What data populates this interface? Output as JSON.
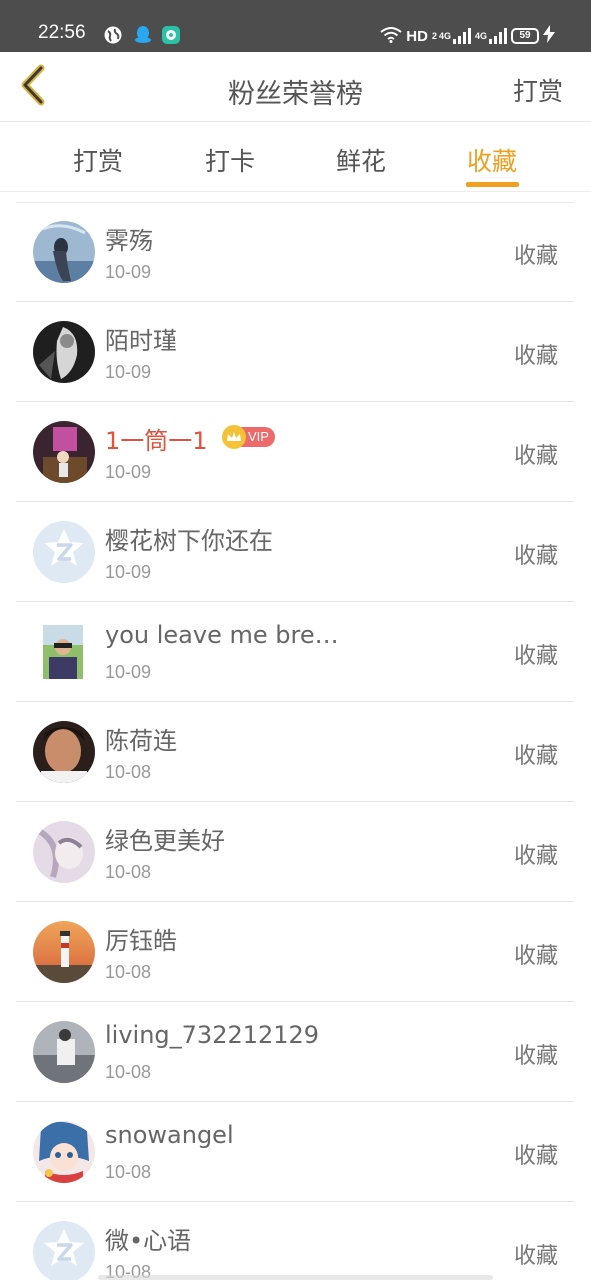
{
  "status_bar": {
    "time": "22:56",
    "left_icons": [
      "globe-icon",
      "qq-icon",
      "chat-app-icon"
    ],
    "hd_label": "HD",
    "hd_sub": "2",
    "net1": "4G",
    "net2": "4G",
    "battery": "59"
  },
  "nav": {
    "title": "粉丝荣誉榜",
    "right_label": "打赏",
    "back_icon": "chevron-left-icon",
    "accent_color": "#f0a020"
  },
  "tabs": [
    {
      "label": "打赏",
      "active": false
    },
    {
      "label": "打卡",
      "active": false
    },
    {
      "label": "鲜花",
      "active": false
    },
    {
      "label": "收藏",
      "active": true
    }
  ],
  "fans": [
    {
      "name": "霁殇",
      "date": "10-09",
      "action": "收藏",
      "vip": false
    },
    {
      "name": "陌时瑾",
      "date": "10-09",
      "action": "收藏",
      "vip": false
    },
    {
      "name": "1一筒一1",
      "date": "10-09",
      "action": "收藏",
      "vip": true,
      "vip_label": "VIP"
    },
    {
      "name": "樱花树下你还在",
      "date": "10-09",
      "action": "收藏",
      "vip": false
    },
    {
      "name": "you leave me brea...",
      "date": "10-09",
      "action": "收藏",
      "vip": false
    },
    {
      "name": "陈荷连",
      "date": "10-08",
      "action": "收藏",
      "vip": false
    },
    {
      "name": "绿色更美好",
      "date": "10-08",
      "action": "收藏",
      "vip": false
    },
    {
      "name": "厉钰皓",
      "date": "10-08",
      "action": "收藏",
      "vip": false
    },
    {
      "name": "living_732212129",
      "date": "10-08",
      "action": "收藏",
      "vip": false
    },
    {
      "name": "snowangel",
      "date": "10-08",
      "action": "收藏",
      "vip": false
    },
    {
      "name": "微•心语",
      "date": "10-08",
      "action": "收藏",
      "vip": false
    }
  ]
}
